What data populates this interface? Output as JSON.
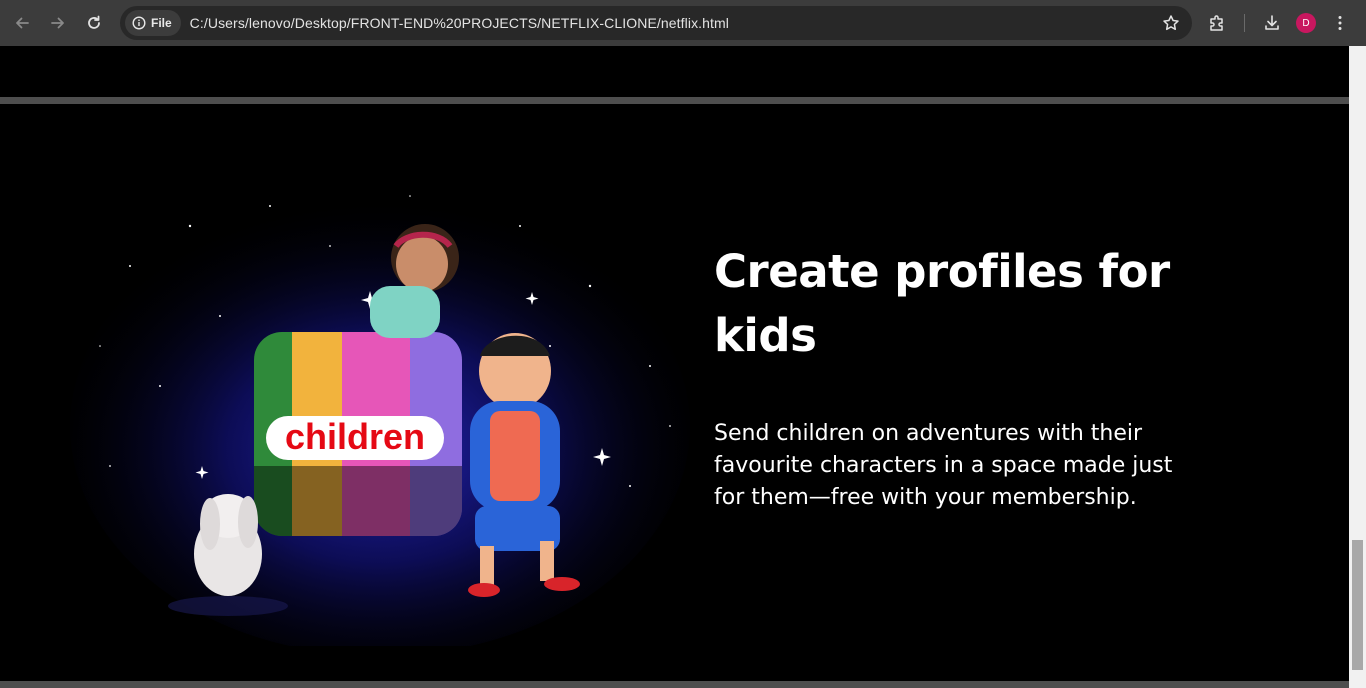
{
  "browser": {
    "site_chip": "File",
    "url": "C:/Users/lenovo/Desktop/FRONT-END%20PROJECTS/NETFLIX-CLIONE/netflix.html",
    "avatar_letter": "D",
    "icons": [
      "back-icon",
      "forward-icon",
      "reload-icon",
      "info-icon",
      "star-icon",
      "extensions-icon",
      "download-icon",
      "menu-icon"
    ]
  },
  "section": {
    "title_line1": "Create profiles for",
    "title_line2": "kids",
    "description_line1": "Send children on adventures with their",
    "description_line2": "favourite characters in a space made just",
    "description_line3": "for them—free with your membership.",
    "image_label": "children"
  },
  "colors": {
    "chrome_bg": "#3c3c3c",
    "omnibox_bg": "#282828",
    "page_bg": "#000000",
    "divider": "#4e4e4e",
    "avatar": "#c8175f",
    "logo_red": "#e50914"
  }
}
